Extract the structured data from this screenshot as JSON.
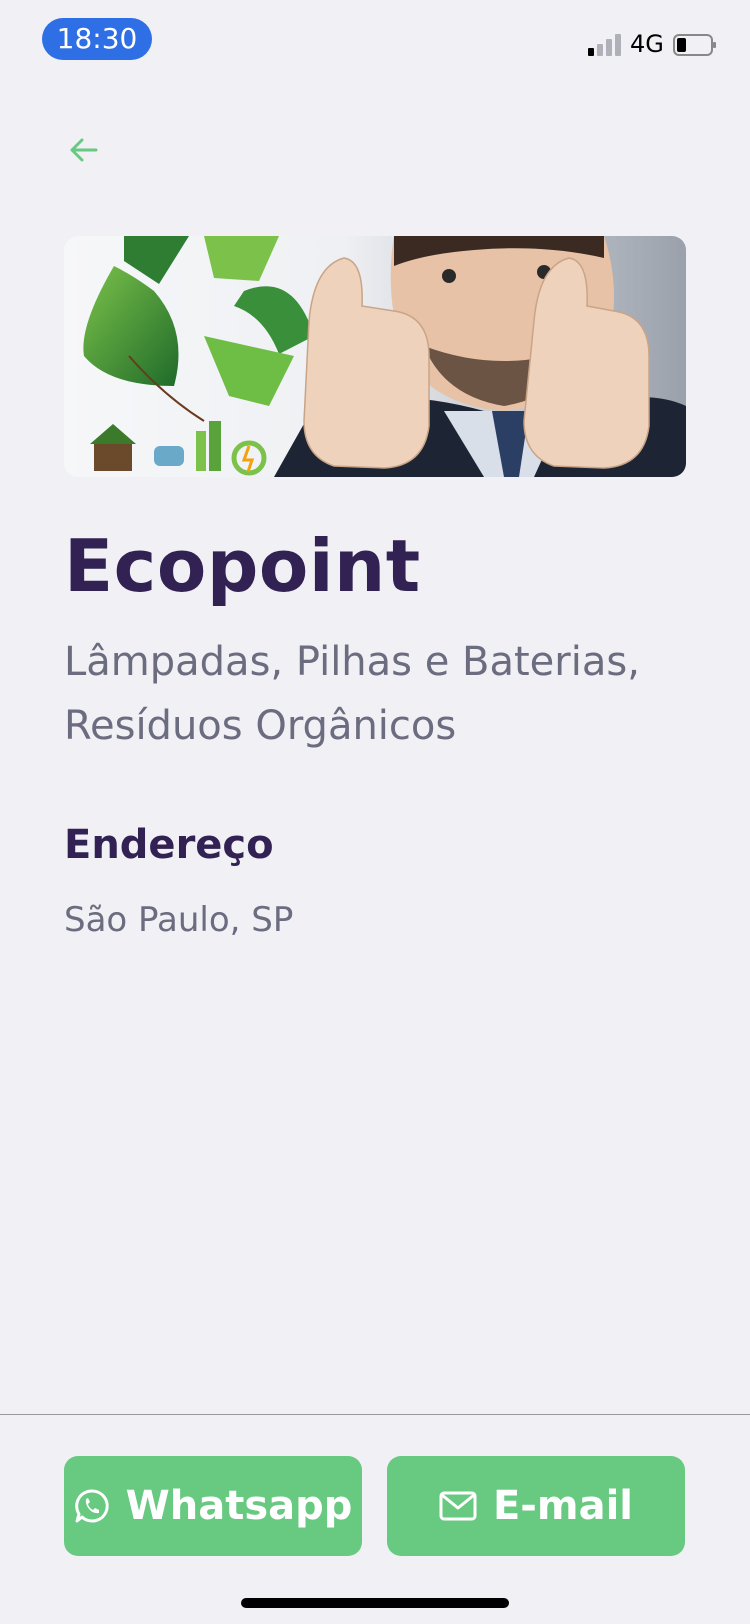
{
  "status_bar": {
    "time": "18:30",
    "network": "4G"
  },
  "point": {
    "name": "Ecopoint",
    "items": "Lâmpadas, Pilhas e Baterias, Resíduos Orgânicos"
  },
  "address": {
    "title": "Endereço",
    "city_state": "São Paulo, SP"
  },
  "footer": {
    "whatsapp_label": "Whatsapp",
    "email_label": "E-mail"
  },
  "colors": {
    "primary": "#68c981",
    "title": "#322153",
    "text": "#6c6c80",
    "background": "#f0f0f5"
  }
}
